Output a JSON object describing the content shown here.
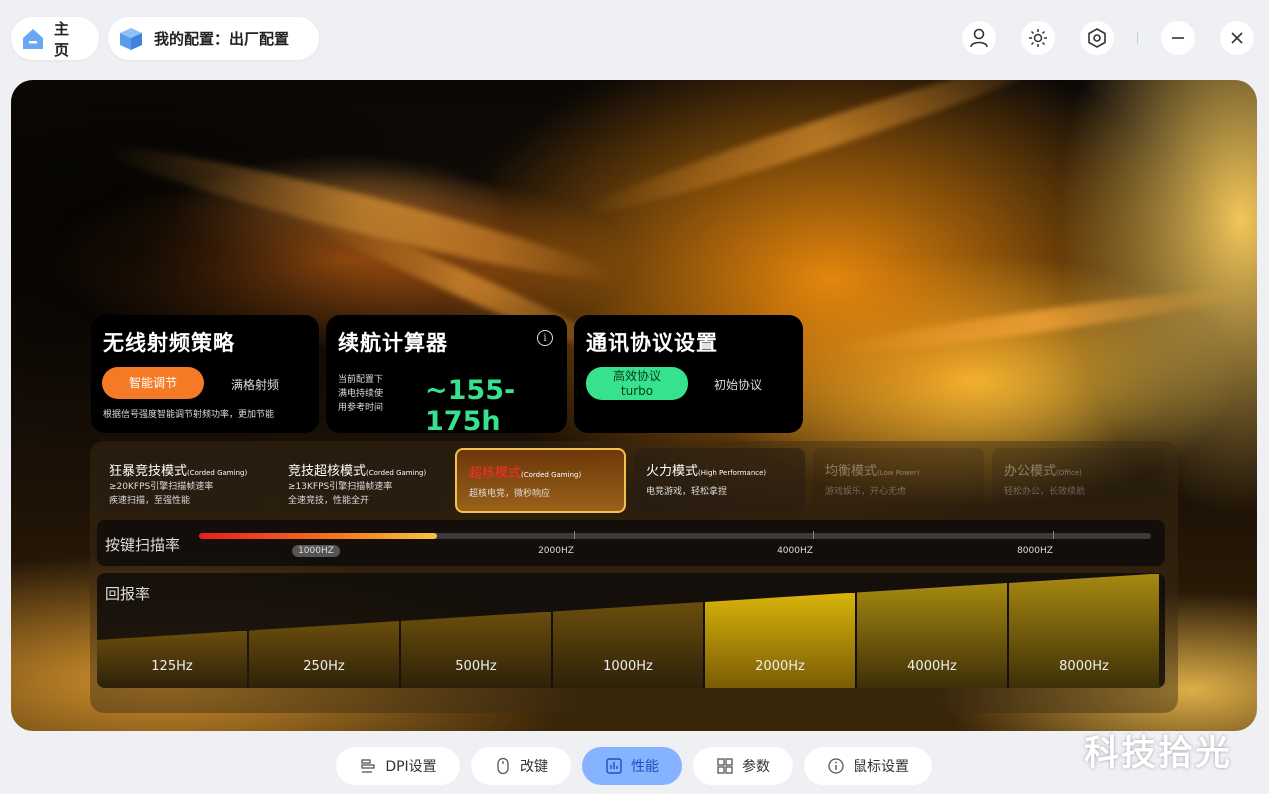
{
  "topbar": {
    "home_label": "主页",
    "profile_label": "我的配置：出厂配置"
  },
  "cards": {
    "radio": {
      "title": "无线射频策略",
      "option_on": "智能调节",
      "option_off": "满格射频",
      "desc": "根据信号强度智能调节射频功率，更加节能"
    },
    "battery": {
      "title": "续航计算器",
      "note_line1": "当前配置下",
      "note_line2": "满电持续使",
      "note_line3": "用参考时间",
      "value": "~155-175h",
      "info_glyph": "i"
    },
    "protocol": {
      "title": "通讯协议设置",
      "option_on_line1": "高效协议",
      "option_on_line2": "turbo",
      "option_off": "初始协议"
    }
  },
  "modes": [
    {
      "name": "狂暴竞技模式",
      "sub": "(Corded Gaming)",
      "line1": "≥20KFPS引擎扫描帧速率",
      "line2": "疾速扫描，至强性能"
    },
    {
      "name": "竞技超核模式",
      "sub": "(Corded Gaming)",
      "line1": "≥13KFPS引擎扫描帧速率",
      "line2": "全速竞技，性能全开"
    },
    {
      "name": "超核模式",
      "sub": "(Corded Gaming)",
      "line1": "超核电竞，微秒响应",
      "line2": ""
    },
    {
      "name": "火力模式",
      "sub": "(High Performance)",
      "line1": "电竞游戏，轻松拿捏",
      "line2": ""
    },
    {
      "name": "均衡模式",
      "sub": "(Low Power)",
      "line1": "游戏娱乐，开心无虑",
      "line2": ""
    },
    {
      "name": "办公模式",
      "sub": "(Office)",
      "line1": "轻松办公，长效续航",
      "line2": ""
    }
  ],
  "active_mode_index": 2,
  "scan_rate": {
    "label": "按键扫描率",
    "points": [
      "1000HZ",
      "2000HZ",
      "4000HZ",
      "8000HZ"
    ],
    "selected": "1000HZ",
    "fill_fraction": 0.25
  },
  "report_rate": {
    "label": "回报率",
    "options": [
      "125Hz",
      "250Hz",
      "500Hz",
      "1000Hz",
      "2000Hz",
      "4000Hz",
      "8000Hz"
    ],
    "selected": "2000Hz"
  },
  "nav": {
    "dpi": "DPI设置",
    "keys": "改键",
    "perf": "性能",
    "params": "参数",
    "mouse": "鼠标设置"
  },
  "watermark": "科技拾光",
  "colors": {
    "accent_green": "#36e28d",
    "accent_orange": "#f57a25",
    "nav_active": "#86b3ff",
    "mode_active_text": "#ff2a2a"
  }
}
